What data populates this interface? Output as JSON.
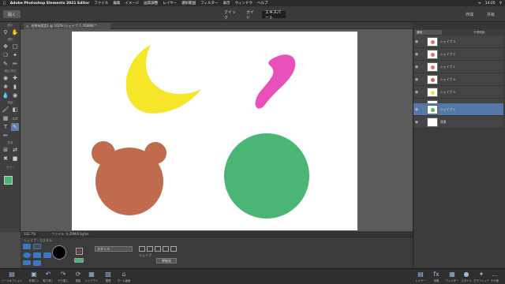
{
  "menubar": {
    "app": "Adobe Photoshop Elements 2021 Editor",
    "items": [
      "ファイル",
      "編集",
      "イメージ",
      "画質調整",
      "レイヤー",
      "選択範囲",
      "フィルター",
      "表示",
      "ウィンドウ",
      "ヘルプ"
    ],
    "clock": "14:05"
  },
  "topbar": {
    "open": "開く",
    "modes": [
      "クイック",
      "ガイド",
      "エキスパート"
    ],
    "create": "作成",
    "share": "共有"
  },
  "toolbox": {
    "sections": [
      "表示",
      "選択",
      "補正/修正",
      "描画",
      "変更",
      "カラー"
    ]
  },
  "document": {
    "tab": "名称未設定1 @ 102% (シェイプ 7, RGB/8) *"
  },
  "status": {
    "zoom": "102.7%",
    "file": "ファイル: 6.29M/0 bytes"
  },
  "options": {
    "title": "シェイプ - カスタム",
    "style": "スタイル",
    "shape_label": "シェイプ",
    "simplify": "単純化"
  },
  "layers_panel": {
    "blend": "通常",
    "opacity": "不透明度:",
    "layers": [
      {
        "name": "シェイプ 3",
        "marker": "#e07070"
      },
      {
        "name": "シェイプ 2",
        "marker": "#e07070"
      },
      {
        "name": "シェイプ 1",
        "marker": "#e07070"
      },
      {
        "name": "シェイプ 4",
        "marker": "#c8654a"
      },
      {
        "name": "シェイプ 5",
        "marker": "#f0e040"
      },
      {
        "name": "シェイプ 6",
        "marker": "#e050b0"
      },
      {
        "name": "シェイプ 7",
        "marker": "#4fb66f"
      },
      {
        "name": "背景",
        "marker": "#ffffff"
      }
    ]
  },
  "bottombar": {
    "left": [
      "ツールオプション",
      "写真ビン",
      "取り消し",
      "やり直し",
      "回転",
      "レイアウト",
      "整理",
      "ホーム画面"
    ],
    "right": [
      "レイヤー",
      "効果",
      "フィルター",
      "スタイル",
      "グラフィック",
      "その他"
    ]
  },
  "colors": {
    "moon": "#f5e629",
    "blob": "#e851b8",
    "bear": "#c06a4e",
    "circle": "#4ab574",
    "accent": "#5479a8"
  }
}
